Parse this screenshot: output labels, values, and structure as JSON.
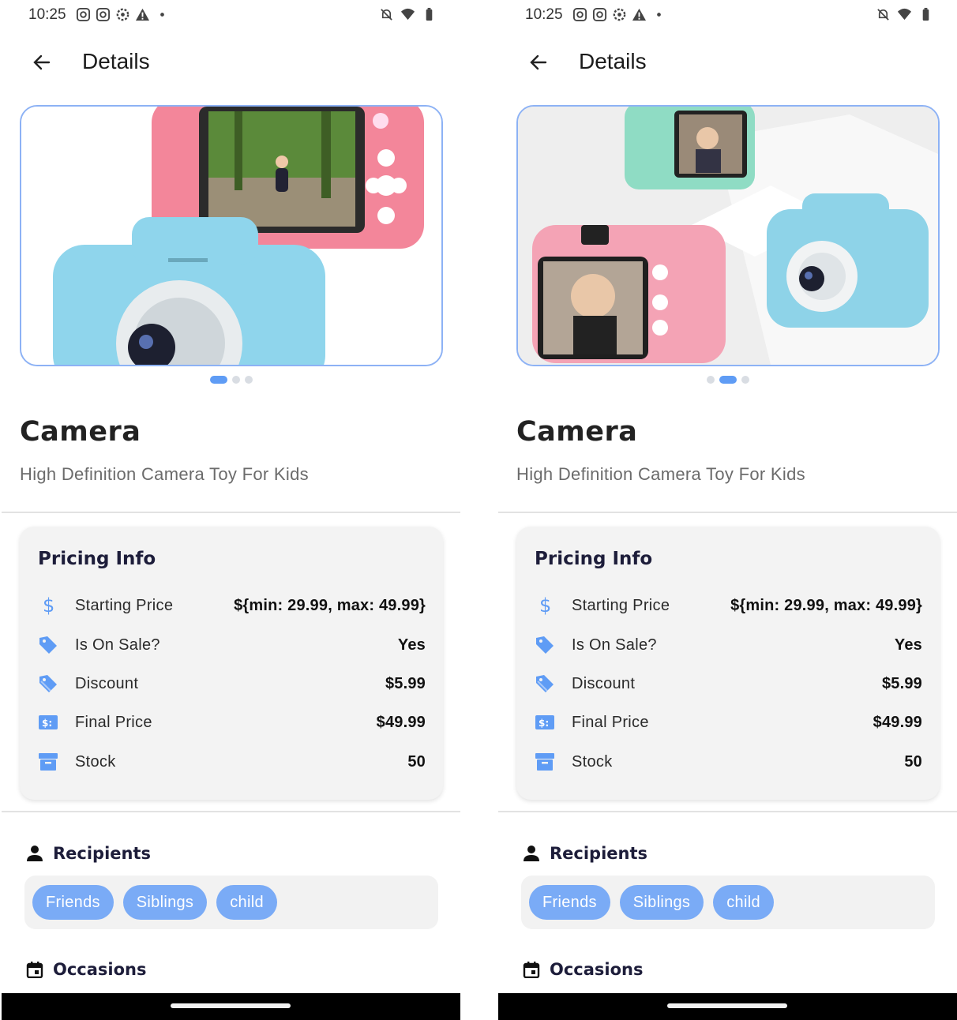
{
  "screens": [
    {
      "status": {
        "time": "10:25"
      },
      "appbar": {
        "title": "Details"
      },
      "carousel": {
        "image": "camera-toy-photo-1",
        "active_dot": 0,
        "dot_count": 3
      },
      "product": {
        "name": "Camera",
        "description": "High Definition Camera Toy For Kids"
      },
      "pricing": {
        "title": "Pricing Info",
        "rows": [
          {
            "icon": "dollar-icon",
            "label": "Starting Price",
            "value": "${min: 29.99, max: 49.99}"
          },
          {
            "icon": "tag-icon",
            "label": "Is On Sale?",
            "value": "Yes"
          },
          {
            "icon": "discount-tag-icon",
            "label": "Discount",
            "value": "$5.99"
          },
          {
            "icon": "money-icon",
            "label": "Final Price",
            "value": "$49.99"
          },
          {
            "icon": "box-icon",
            "label": "Stock",
            "value": "50"
          }
        ]
      },
      "recipients": {
        "title": "Recipients",
        "chips": [
          "Friends",
          "Siblings",
          "child"
        ]
      },
      "occasions": {
        "title": "Occasions"
      }
    },
    {
      "status": {
        "time": "10:25"
      },
      "appbar": {
        "title": "Details"
      },
      "carousel": {
        "image": "camera-toy-photo-2",
        "active_dot": 1,
        "dot_count": 3
      },
      "product": {
        "name": "Camera",
        "description": "High Definition Camera Toy For Kids"
      },
      "pricing": {
        "title": "Pricing Info",
        "rows": [
          {
            "icon": "dollar-icon",
            "label": "Starting Price",
            "value": "${min: 29.99, max: 49.99}"
          },
          {
            "icon": "tag-icon",
            "label": "Is On Sale?",
            "value": "Yes"
          },
          {
            "icon": "discount-tag-icon",
            "label": "Discount",
            "value": "$5.99"
          },
          {
            "icon": "money-icon",
            "label": "Final Price",
            "value": "$49.99"
          },
          {
            "icon": "box-icon",
            "label": "Stock",
            "value": "50"
          }
        ]
      },
      "recipients": {
        "title": "Recipients",
        "chips": [
          "Friends",
          "Siblings",
          "child"
        ]
      },
      "occasions": {
        "title": "Occasions"
      }
    }
  ],
  "colors": {
    "accent": "#5f9cf5",
    "chip": "#7aabf6",
    "card": "#f3f3f3",
    "heading": "#1d1d3a"
  }
}
